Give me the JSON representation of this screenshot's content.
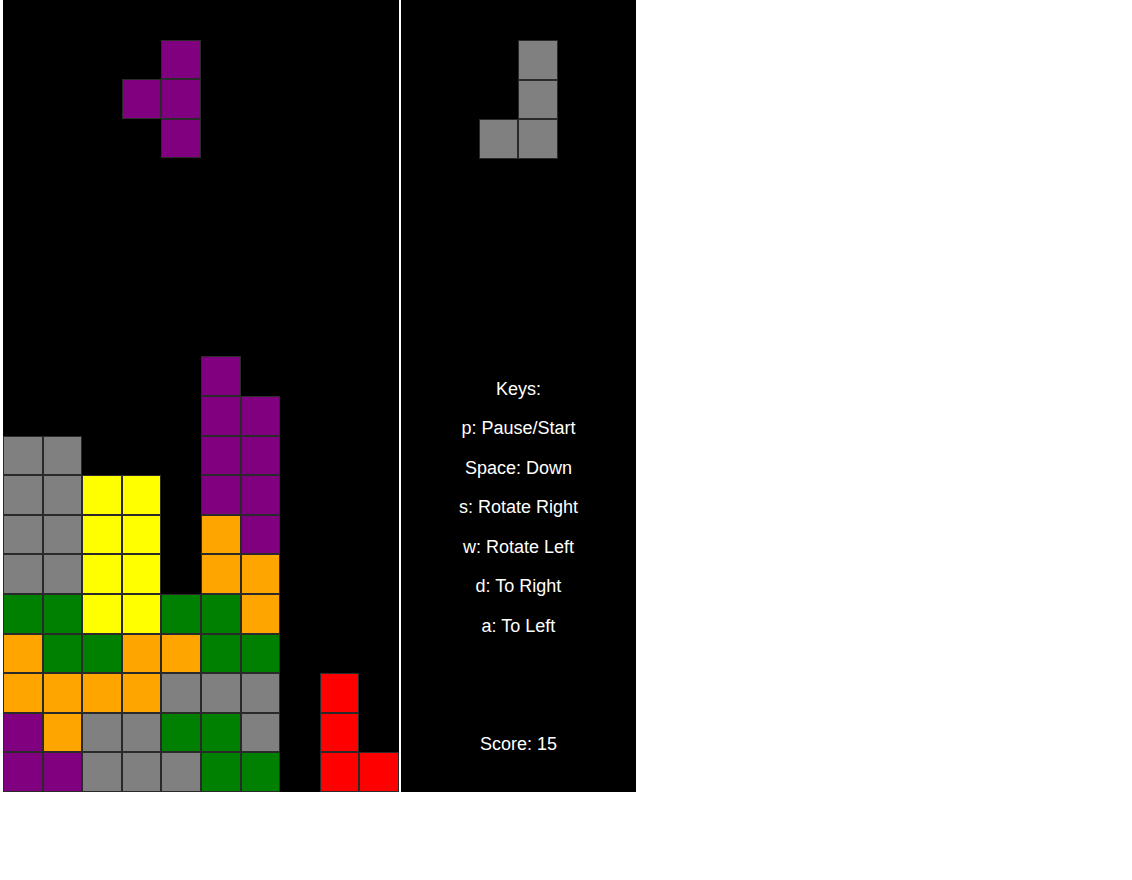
{
  "board": {
    "columns": 10,
    "rows": 20,
    "cells": [
      [
        null,
        null,
        null,
        null,
        null,
        null,
        null,
        null,
        null,
        null
      ],
      [
        null,
        null,
        null,
        null,
        null,
        null,
        null,
        null,
        null,
        null
      ],
      [
        null,
        null,
        null,
        null,
        null,
        null,
        null,
        null,
        null,
        null
      ],
      [
        null,
        null,
        null,
        null,
        null,
        null,
        null,
        null,
        null,
        null
      ],
      [
        null,
        null,
        null,
        null,
        null,
        null,
        null,
        null,
        null,
        null
      ],
      [
        null,
        null,
        null,
        null,
        null,
        null,
        null,
        null,
        null,
        null
      ],
      [
        null,
        null,
        null,
        null,
        null,
        null,
        null,
        null,
        null,
        null
      ],
      [
        null,
        null,
        null,
        null,
        null,
        null,
        null,
        null,
        null,
        null
      ],
      [
        null,
        null,
        null,
        null,
        null,
        null,
        null,
        null,
        null,
        null
      ],
      [
        null,
        null,
        null,
        null,
        null,
        "#800080",
        null,
        null,
        null,
        null
      ],
      [
        null,
        null,
        null,
        null,
        null,
        "#800080",
        "#800080",
        null,
        null,
        null
      ],
      [
        "#808080",
        "#808080",
        null,
        null,
        null,
        "#800080",
        "#800080",
        null,
        null,
        null
      ],
      [
        "#808080",
        "#808080",
        "#ffff00",
        "#ffff00",
        null,
        "#800080",
        "#800080",
        null,
        null,
        null
      ],
      [
        "#808080",
        "#808080",
        "#ffff00",
        "#ffff00",
        null,
        "#ffa500",
        "#800080",
        null,
        null,
        null
      ],
      [
        "#808080",
        "#808080",
        "#ffff00",
        "#ffff00",
        null,
        "#ffa500",
        "#ffa500",
        null,
        null,
        null
      ],
      [
        "#008000",
        "#008000",
        "#ffff00",
        "#ffff00",
        "#008000",
        "#008000",
        "#ffa500",
        null,
        null,
        null
      ],
      [
        "#ffa500",
        "#008000",
        "#008000",
        "#ffa500",
        "#ffa500",
        "#008000",
        "#008000",
        null,
        null,
        null
      ],
      [
        "#ffa500",
        "#ffa500",
        "#ffa500",
        "#ffa500",
        "#808080",
        "#808080",
        "#808080",
        null,
        "#ff0000",
        null
      ],
      [
        "#800080",
        "#ffa500",
        "#808080",
        "#808080",
        "#008000",
        "#008000",
        "#808080",
        null,
        "#ff0000",
        null
      ],
      [
        "#800080",
        "#800080",
        "#808080",
        "#808080",
        "#808080",
        "#008000",
        "#008000",
        null,
        "#ff0000",
        "#ff0000"
      ]
    ]
  },
  "active_piece": {
    "color": "#800080",
    "cells": [
      [
        1,
        4
      ],
      [
        2,
        3
      ],
      [
        2,
        4
      ],
      [
        3,
        4
      ]
    ]
  },
  "next_piece": {
    "color": "#808080",
    "shape": [
      [
        0,
        1
      ],
      [
        0,
        1
      ],
      [
        1,
        1
      ]
    ]
  },
  "keys": {
    "title": "Keys:",
    "items": [
      "p: Pause/Start",
      "Space: Down",
      "s: Rotate Right",
      "w: Rotate Left",
      "d: To Right",
      "a: To Left"
    ]
  },
  "score": "Score: 15"
}
